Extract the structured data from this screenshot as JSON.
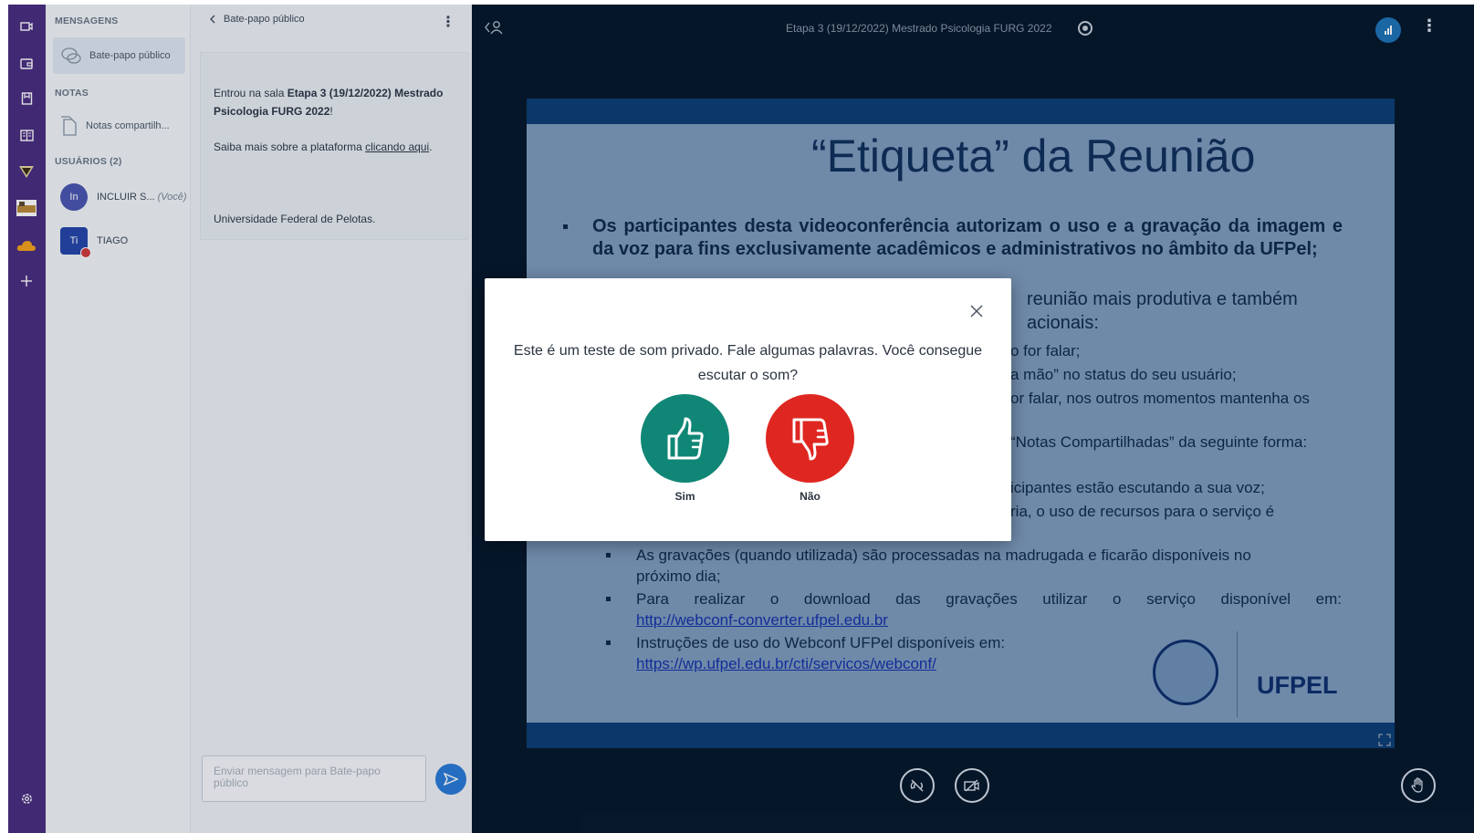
{
  "sidebar": {
    "messages_heading": "MENSAGENS",
    "public_chat": "Bate-papo público",
    "notes_heading": "NOTAS",
    "shared_notes": "Notas compartilh...",
    "users_heading": "USUÁRIOS (2)",
    "users": [
      {
        "initials": "In",
        "name": "INCLUIR S...",
        "you": "(Você)"
      },
      {
        "initials": "Ti",
        "name": "TIAGO"
      }
    ]
  },
  "chat": {
    "back_label": "Bate-papo público",
    "welcome_prefix": "Entrou na sala ",
    "welcome_room": "Etapa 3 (19/12/2022) Mestrado Psicologia FURG 2022",
    "welcome_suffix": "!",
    "more_info_prefix": "Saiba mais sobre a plataforma ",
    "more_info_link": "clicando aqui",
    "more_info_suffix": ".",
    "university": "Universidade Federal de Pelotas.",
    "input_placeholder": "Enviar mensagem para Bate-papo público"
  },
  "meeting": {
    "title": "Etapa 3 (19/12/2022) Mestrado Psicologia FURG 2022"
  },
  "slide": {
    "title": "“Etiqueta” da Reunião",
    "p1": "Os participantes desta videoconferência autorizam o uso e a gravação da imagem e da voz para fins exclusivamente acadêmicos e administrativos no âmbito da UFPel;",
    "p2a": "reunião mais produtiva e também",
    "p2b": "acionais:",
    "l3": "o for falar;",
    "l4": "a mão” no status do seu usuário;",
    "l5": "or falar, nos outros momentos mantenha os",
    "l6": "“Notas Compartilhadas” da seguinte forma:",
    "l7": "icipantes estão escutando a sua voz;",
    "l8": "ria, o uso de recursos para o serviço é",
    "l9": "As gravações (quando utilizada) são processadas na madrugada e ficarão disponíveis no",
    "l9b": "próximo dia;",
    "l10": "Para realizar o download das gravações utilizar o serviço disponível em:",
    "l10_link": "http://webconf-converter.ufpel.edu.br",
    "l11": "Instruções de uso do Webconf UFPel disponíveis em:",
    "l11_link": "https://wp.ufpel.edu.br/cti/servicos/webconf/",
    "logo_text": "UFPEL"
  },
  "modal": {
    "question": "Este é um teste de som privado. Fale algumas palavras. Você consegue escutar o som?",
    "yes": "Sim",
    "no": "Não"
  },
  "colors": {
    "rail": "#4a2d7e",
    "yes": "#108676",
    "no": "#df2721",
    "accent": "#2a7ad6"
  }
}
